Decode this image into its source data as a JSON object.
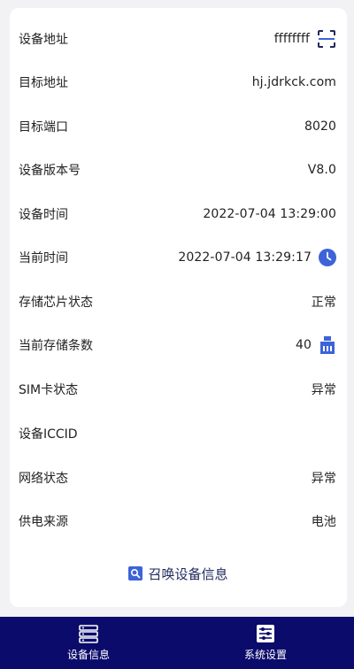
{
  "rows": [
    {
      "label": "设备地址",
      "value": "ffffffff",
      "icon": "scan-icon"
    },
    {
      "label": "目标地址",
      "value": "hj.jdrkck.com"
    },
    {
      "label": "目标端口",
      "value": "8020"
    },
    {
      "label": "设备版本号",
      "value": "V8.0"
    },
    {
      "label": "设备时间",
      "value": "2022-07-04 13:29:00"
    },
    {
      "label": "当前时间",
      "value": "2022-07-04 13:29:17",
      "icon": "clock-icon"
    },
    {
      "label": "存储芯片状态",
      "value": "正常"
    },
    {
      "label": "当前存储条数",
      "value": "40",
      "icon": "storage-chip-icon"
    },
    {
      "label": "SIM卡状态",
      "value": "异常"
    },
    {
      "label": "设备ICCID",
      "value": ""
    },
    {
      "label": "网络状态",
      "value": "异常"
    },
    {
      "label": "供电来源",
      "value": "电池"
    }
  ],
  "summon_button": {
    "label": "召唤设备信息",
    "icon": "search-icon"
  },
  "tabs": [
    {
      "label": "设备信息",
      "icon": "server-icon"
    },
    {
      "label": "系统设置",
      "icon": "sliders-icon"
    }
  ],
  "colors": {
    "accent": "#3d63d9",
    "tabbar": "#0b0b6b",
    "background": "#f2f2f4"
  }
}
